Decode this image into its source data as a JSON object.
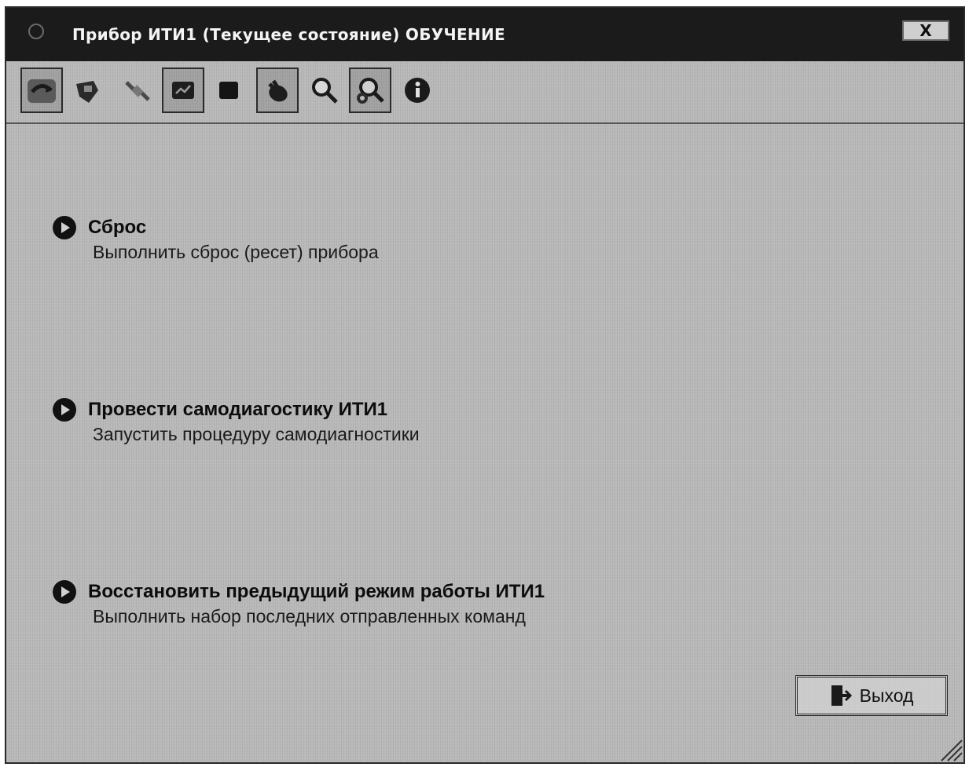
{
  "window": {
    "title": "Прибор ИТИ1 (Текущее состояние) ОБУЧЕНИЕ",
    "close_label": "X"
  },
  "toolbar": {
    "buttons": [
      {
        "icon": "connect-icon",
        "pressed": true
      },
      {
        "icon": "device-icon",
        "pressed": false
      },
      {
        "icon": "cable-icon",
        "pressed": false
      },
      {
        "icon": "monitor-icon",
        "pressed": true
      },
      {
        "icon": "stop-icon",
        "pressed": false
      },
      {
        "icon": "hand-icon",
        "pressed": true
      },
      {
        "icon": "search-icon",
        "pressed": false
      },
      {
        "icon": "magnifier-settings-icon",
        "pressed": true
      },
      {
        "icon": "info-icon",
        "pressed": false
      }
    ]
  },
  "actions": [
    {
      "title": "Сброс",
      "description": "Выполнить сброс (ресет) прибора"
    },
    {
      "title": "Провести самодиагостику ИТИ1",
      "description": "Запустить процедуру самодиагностики"
    },
    {
      "title": "Восстановить предыдущий режим работы ИТИ1",
      "description": "Выполнить набор последних отправленных команд"
    }
  ],
  "exit_button": {
    "label": "Выход",
    "icon": "exit-door-icon"
  },
  "colors": {
    "titlebar": "#1b1b1b",
    "background": "#b9b9b9",
    "text": "#0c0c0c"
  }
}
